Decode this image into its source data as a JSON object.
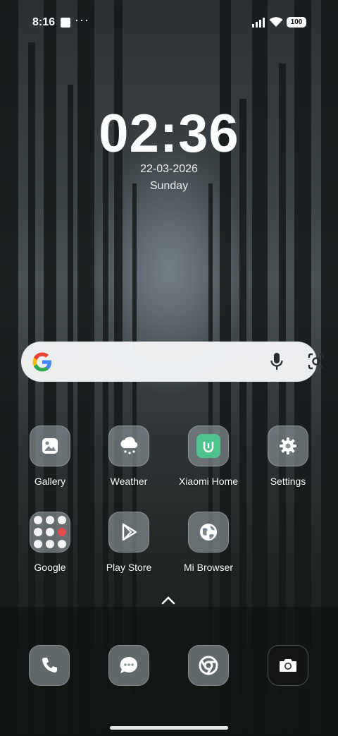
{
  "status_bar": {
    "time": "8:16",
    "overflow": "···",
    "battery": "100",
    "icons": [
      "square-notification-icon",
      "signal-icon",
      "wifi-icon",
      "battery-icon"
    ]
  },
  "clock_widget": {
    "time": "02:36",
    "date": "22-03-2026",
    "day": "Sunday"
  },
  "search_bar": {
    "icons": [
      "google-logo-icon",
      "microphone-icon",
      "google-lens-icon"
    ]
  },
  "apps": [
    {
      "label": "Gallery",
      "icon": "gallery-icon"
    },
    {
      "label": "Weather",
      "icon": "weather-icon"
    },
    {
      "label": "Xiaomi Home",
      "icon": "xiaomi-home-icon"
    },
    {
      "label": "Settings",
      "icon": "gear-icon"
    },
    {
      "label": "Google",
      "icon": "folder-icon"
    },
    {
      "label": "Play Store",
      "icon": "play-store-icon"
    },
    {
      "label": "Mi Browser",
      "icon": "globe-icon"
    }
  ],
  "dock": [
    {
      "icon": "phone-icon"
    },
    {
      "icon": "messages-icon"
    },
    {
      "icon": "chrome-icon"
    },
    {
      "icon": "camera-icon"
    }
  ],
  "colors": {
    "search_bar_bg": "#f4f6f8",
    "tile_bg": "#919ba0",
    "xiaomi_home_green": "#4fc48d"
  }
}
